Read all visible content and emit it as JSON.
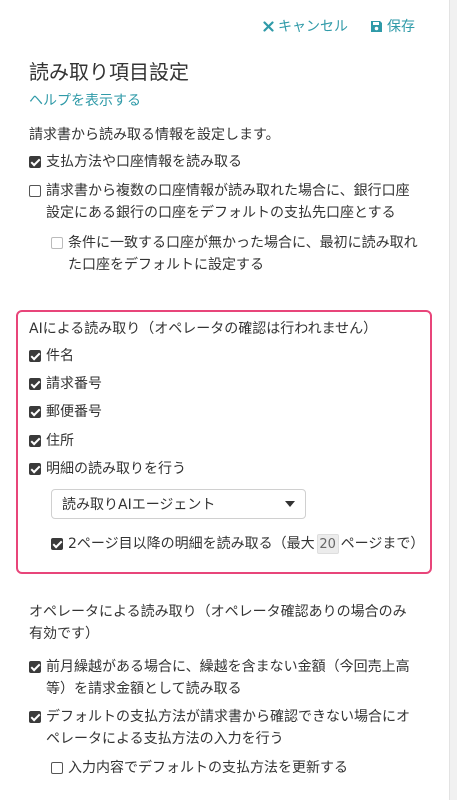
{
  "header": {
    "cancel_label": "キャンセル",
    "save_label": "保存",
    "accent": "#2f9aa8"
  },
  "page": {
    "title": "読み取り項目設定",
    "help_link": "ヘルプを表示する",
    "description": "請求書から読み取る情報を設定します。"
  },
  "general": {
    "read_payment": {
      "label": "支払方法や口座情報を読み取る",
      "checked": true
    },
    "multi_account_line1": "請求書から複数の口座情報が読み取れた場合に、銀行口座",
    "multi_account_line2": "設定にある銀行の口座をデフォルトの支払先口座とする",
    "multi_account_checked": false,
    "no_match_line1": "条件に一致する口座が無かった場合に、最初に読み取れ",
    "no_match_line2": "た口座をデフォルトに設定する",
    "no_match_checked": false
  },
  "ai_section": {
    "border_color": "#e8457a",
    "title": "AIによる読み取り（オペレータの確認は行われません）",
    "items": [
      {
        "label": "件名",
        "checked": true
      },
      {
        "label": "請求番号",
        "checked": true
      },
      {
        "label": "郵便番号",
        "checked": true
      },
      {
        "label": "住所",
        "checked": true
      },
      {
        "label": "明細の読み取りを行う",
        "checked": true
      }
    ],
    "agent_select_value": "読み取りAIエージェント",
    "page2_prefix": "2ページ目以降の明細を読み取る（最大",
    "page2_max": "20",
    "page2_suffix": "ページまで）",
    "page2_checked": true
  },
  "operator_section": {
    "title_line1": "オペレータによる読み取り（オペレータ確認ありの場合のみ",
    "title_line2": "有効です）",
    "carryover_line1": "前月繰越がある場合に、繰越を含まない金額（今回売上高",
    "carryover_line2": "等）を請求金額として読み取る",
    "carryover_checked": true,
    "default_pay_line1": "デフォルトの支払方法が請求書から確認できない場合にオ",
    "default_pay_line2": "ペレータによる支払方法の入力を行う",
    "default_pay_checked": true,
    "update_default": "入力内容でデフォルトの支払方法を更新する",
    "update_default_checked": false
  }
}
